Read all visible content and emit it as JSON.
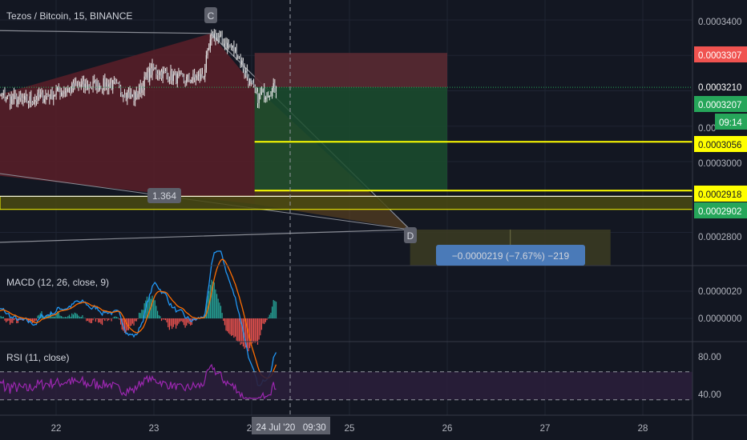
{
  "header": {
    "title": "Tezos / Bitcoin, 15, BINANCE"
  },
  "colors": {
    "background": "#131722",
    "grid": "#1f2433",
    "up": "#ef5350",
    "down": "#26a69a",
    "candle": "#e8e8e8",
    "yellow": "#ffff00",
    "macd_line": "#2196f3",
    "signal_line": "#ff6d00",
    "rsi_line": "#9c27b0",
    "rsi_band": "#2a1e3a",
    "pattern_fill": "#5a1e28",
    "stop_zone": "#5a2a32",
    "target_zone": "#1b4d2e",
    "range_box": "#3a3a22",
    "measure_label": "#4a7ab8"
  },
  "price_axis": {
    "ticks": [
      "0.0003400",
      "0.0003000",
      "0.0002800",
      "0.00"
    ],
    "badges": {
      "stop": "0.0003307",
      "last": "0.0003210",
      "entry": "0.0003207",
      "countdown": "09:14",
      "level1": "0.0003056",
      "level2": "0.0002918",
      "level3": "0.0002902"
    }
  },
  "macd_panel": {
    "label": "MACD (12, 26, close, 9)",
    "ticks": [
      "0.0000020",
      "0.0000000"
    ]
  },
  "rsi_panel": {
    "label": "RSI (11, close)",
    "ticks": [
      "80.00",
      "40.00"
    ]
  },
  "time_axis": {
    "ticks": [
      "22",
      "23",
      "2",
      "25",
      "26",
      "27",
      "28"
    ],
    "cursor_label": "24 Jul '20   09:30"
  },
  "drawings": {
    "point_c": "C",
    "point_d": "D",
    "ratio": "1.364",
    "measure": "−0.0000219 (−7.67%) −219"
  },
  "chart_data": {
    "type": "candlestick",
    "symbol": "Tezos / Bitcoin",
    "interval": "15",
    "exchange": "BINANCE",
    "price_range": [
      0.000271,
      0.000352
    ],
    "levels": [
      0.0003307,
      0.000321,
      0.0003207,
      0.0003056,
      0.0002918,
      0.0002902
    ],
    "price_anchors": [
      {
        "day": 21.3,
        "price": 0.000319
      },
      {
        "day": 21.7,
        "price": 0.000317
      },
      {
        "day": 22.2,
        "price": 0.000321
      },
      {
        "day": 22.55,
        "price": 0.000322
      },
      {
        "day": 22.8,
        "price": 0.000318
      },
      {
        "day": 22.98,
        "price": 0.000326
      },
      {
        "day": 23.3,
        "price": 0.000323
      },
      {
        "day": 23.5,
        "price": 0.000324
      },
      {
        "day": 23.6,
        "price": 0.000336
      },
      {
        "day": 23.85,
        "price": 0.000331
      },
      {
        "day": 24.05,
        "price": 0.000318
      },
      {
        "day": 24.25,
        "price": 0.000321
      }
    ],
    "macd": {
      "range": [
        -2.2e-06,
        3.5e-06
      ]
    },
    "rsi": {
      "range": [
        30,
        90
      ],
      "upper_band": 70,
      "lower_band": 30
    }
  }
}
